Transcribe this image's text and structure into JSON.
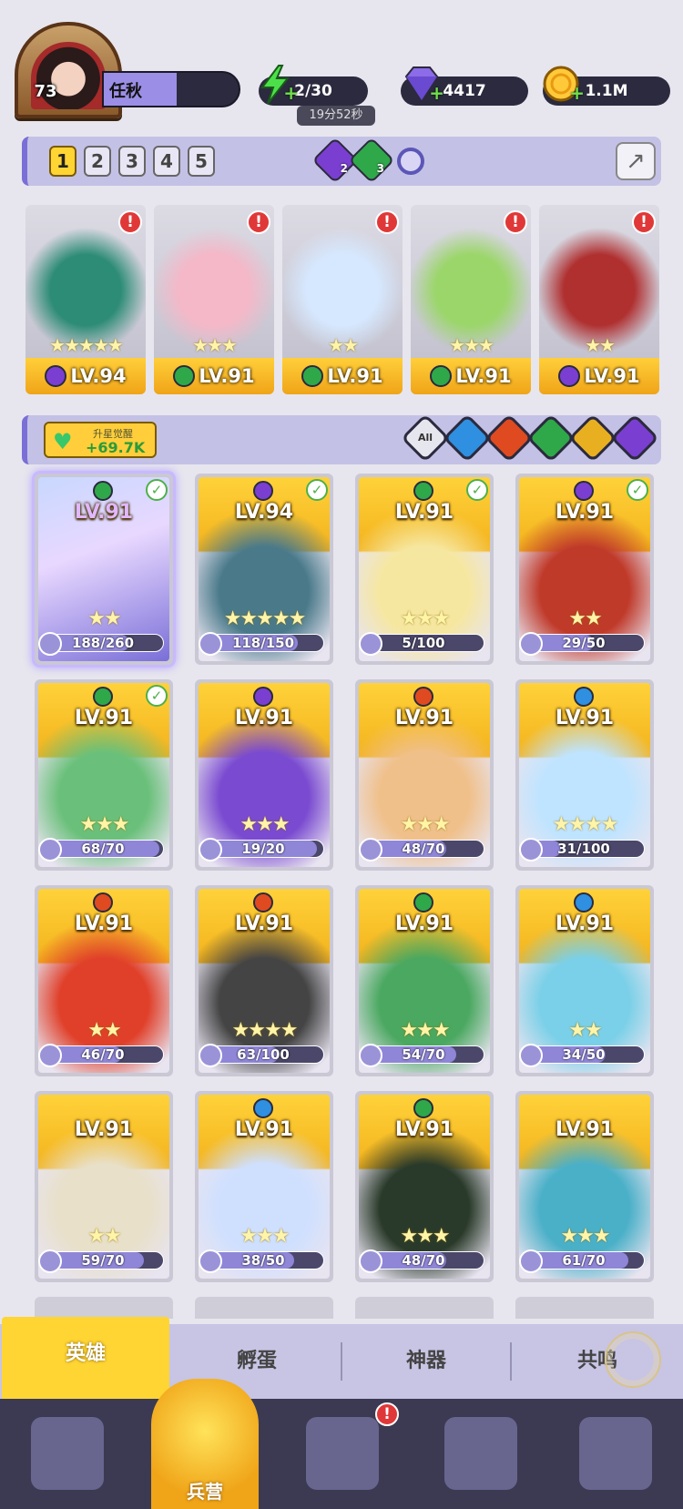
{
  "player": {
    "level": "73",
    "name": "任秋"
  },
  "resources": {
    "energy": {
      "value": "2/30",
      "timer": "19分52秒"
    },
    "gems": {
      "value": "4417"
    },
    "gold": {
      "value": "1.1M"
    }
  },
  "team": {
    "tabs": [
      "1",
      "2",
      "3",
      "4",
      "5"
    ],
    "active_tab": "1",
    "element_counts": [
      {
        "icon": "dark-element-icon",
        "count": "2"
      },
      {
        "icon": "nature-element-icon",
        "count": "3"
      }
    ]
  },
  "team_heroes": [
    {
      "element": "dark",
      "level": "LV.94",
      "stars": "★★★★★",
      "alert": "!"
    },
    {
      "element": "nature",
      "level": "LV.91",
      "stars": "★★★",
      "alert": "!"
    },
    {
      "element": "nature",
      "level": "LV.91",
      "stars": "★★",
      "alert": "!"
    },
    {
      "element": "nature",
      "level": "LV.91",
      "stars": "★★★",
      "alert": "!"
    },
    {
      "element": "dark",
      "level": "LV.91",
      "stars": "★★",
      "alert": "!"
    }
  ],
  "filter": {
    "awaken_label": "升星觉醒",
    "awaken_value": "+69.7K",
    "buttons": [
      "All",
      "water",
      "fire",
      "nature",
      "light",
      "dark"
    ]
  },
  "heroes": [
    {
      "level": "LV.91",
      "element": "nature",
      "shards": "188/260",
      "fill": 0.72,
      "checked": true,
      "stars": "★★"
    },
    {
      "level": "LV.94",
      "element": "dark",
      "shards": "118/150",
      "fill": 0.79,
      "checked": true,
      "stars": "★★★★★"
    },
    {
      "level": "LV.91",
      "element": "nature",
      "shards": "5/100",
      "fill": 0.05,
      "checked": true,
      "stars": "★★★"
    },
    {
      "level": "LV.91",
      "element": "dark",
      "shards": "29/50",
      "fill": 0.58,
      "checked": true,
      "stars": "★★"
    },
    {
      "level": "LV.91",
      "element": "nature",
      "shards": "68/70",
      "fill": 0.97,
      "checked": true,
      "stars": "★★★"
    },
    {
      "level": "LV.91",
      "element": "dark",
      "shards": "19/20",
      "fill": 0.95,
      "checked": false,
      "stars": "★★★"
    },
    {
      "level": "LV.91",
      "element": "fire",
      "shards": "48/70",
      "fill": 0.69,
      "checked": false,
      "stars": "★★★"
    },
    {
      "level": "LV.91",
      "element": "water",
      "shards": "31/100",
      "fill": 0.31,
      "checked": false,
      "stars": "★★★★"
    },
    {
      "level": "LV.91",
      "element": "fire",
      "shards": "46/70",
      "fill": 0.66,
      "checked": false,
      "stars": "★★"
    },
    {
      "level": "LV.91",
      "element": "fire",
      "shards": "63/100",
      "fill": 0.63,
      "checked": false,
      "stars": "★★★★"
    },
    {
      "level": "LV.91",
      "element": "nature",
      "shards": "54/70",
      "fill": 0.77,
      "checked": false,
      "stars": "★★★"
    },
    {
      "level": "LV.91",
      "element": "water",
      "shards": "34/50",
      "fill": 0.68,
      "checked": false,
      "stars": "★★"
    },
    {
      "level": "LV.91",
      "element": "",
      "shards": "59/70",
      "fill": 0.84,
      "checked": false,
      "stars": "★★"
    },
    {
      "level": "LV.91",
      "element": "water",
      "shards": "38/50",
      "fill": 0.76,
      "checked": false,
      "stars": "★★★"
    },
    {
      "level": "LV.91",
      "element": "nature",
      "shards": "48/70",
      "fill": 0.69,
      "checked": false,
      "stars": "★★★"
    },
    {
      "level": "LV.91",
      "element": "",
      "shards": "61/70",
      "fill": 0.87,
      "checked": false,
      "stars": "★★★"
    }
  ],
  "tabs": {
    "heroes": "英雄",
    "eggs": "孵蛋",
    "artifacts": "神器",
    "resonance": "共鸣"
  },
  "nav": {
    "barracks": "兵营",
    "alert": "!"
  },
  "colors": {
    "dark": "#7a3fd0",
    "nature": "#2fa84a",
    "fire": "#e04a20",
    "water": "#2f8fe0",
    "light": "#e8b020",
    "accent": "#ffd534"
  }
}
